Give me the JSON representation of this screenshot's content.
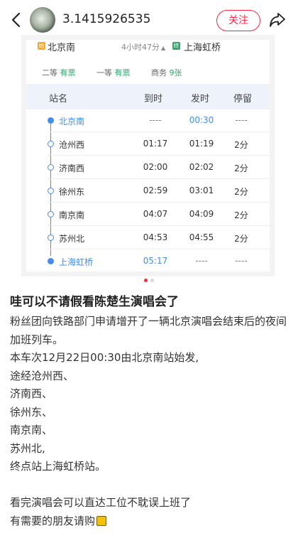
{
  "header": {
    "username": "3.1415926535",
    "follow_label": "关注"
  },
  "ticket": {
    "from_tag": "始",
    "from": "北京南",
    "duration": "4小时47分",
    "duration_arrow": "▲",
    "to_tag": "终",
    "to": "上海虹桥",
    "seats": [
      {
        "class": "二等",
        "status": "有票"
      },
      {
        "class": "一等",
        "status": "有票"
      },
      {
        "class": "商务",
        "status": "9张"
      }
    ],
    "columns": [
      "站名",
      "到时",
      "发时",
      "停留"
    ],
    "stops": [
      {
        "station": "北京南",
        "arrive": "----",
        "depart": "00:30",
        "stay": "----"
      },
      {
        "station": "沧州西",
        "arrive": "01:17",
        "depart": "01:19",
        "stay": "2分"
      },
      {
        "station": "济南西",
        "arrive": "02:00",
        "depart": "02:02",
        "stay": "2分"
      },
      {
        "station": "徐州东",
        "arrive": "02:59",
        "depart": "03:01",
        "stay": "2分"
      },
      {
        "station": "南京南",
        "arrive": "04:07",
        "depart": "04:09",
        "stay": "2分"
      },
      {
        "station": "苏州北",
        "arrive": "04:53",
        "depart": "04:55",
        "stay": "2分"
      },
      {
        "station": "上海虹桥",
        "arrive": "05:17",
        "depart": "----",
        "stay": "----"
      }
    ],
    "colors": {
      "accent": "#3f8ef0",
      "available": "#2fa36b",
      "tag_start": "#f5a623",
      "tag_end": "#2fa36b"
    }
  },
  "pager": {
    "total": 2,
    "active": 0,
    "active_color": "#ff2442",
    "inactive_color": "#d8d8d8"
  },
  "post": {
    "title": "哇可以不请假看陈楚生演唱会了",
    "paragraphs": [
      "粉丝团向铁路部门申请增开了一辆北京演唱会结束后的夜间加班列车。",
      "本车次12月22日00:30由北京南站始发,",
      "途经沧州西、",
      "济南西、",
      "徐州东、",
      "南京南、",
      "苏州北,",
      "终点站上海虹桥站。",
      "",
      "看完演唱会可以直达工位不耽误上班了",
      "有需要的朋友请购"
    ]
  },
  "icons": {
    "back": "chevron-left-icon",
    "share": "share-arrow-icon",
    "emoji": "ticket-emoji-icon"
  }
}
